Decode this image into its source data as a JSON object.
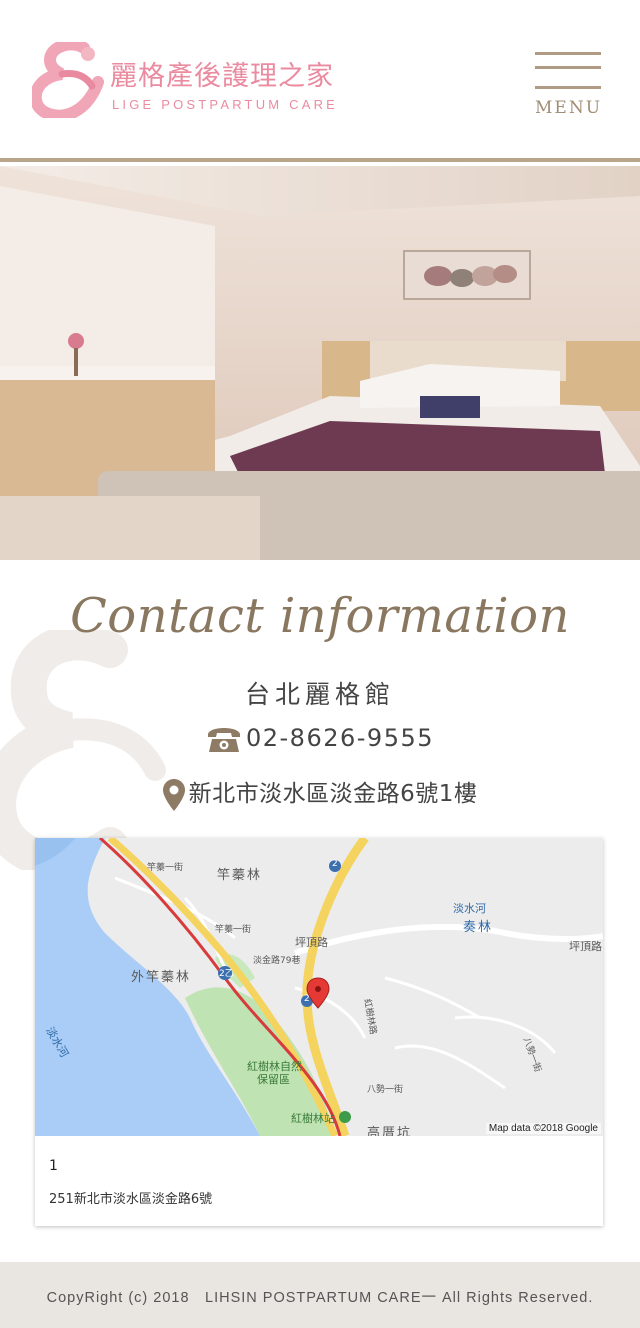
{
  "header": {
    "brand_title": "麗格產後護理之家",
    "brand_subtitle": "LIGE POSTPARTUM CARE",
    "menu_label": "MENU",
    "accent": "#ea8ba0",
    "gold": "#b8a58a"
  },
  "contact": {
    "title": "Contact information",
    "branch": "台北麗格館",
    "phone": "02-8626-9555",
    "address": "新北市淡水區淡金路6號1樓"
  },
  "map": {
    "labels": {
      "north": "竿蓁林",
      "west": "外竿蓁林",
      "reserve1": "紅樹林自然",
      "reserve2": "保留區",
      "station": "紅樹林站",
      "south": "高厝坑",
      "river_ne1": "淡水河",
      "river_ne2": "奏林",
      "river_w": "淡水河",
      "road1": "坪頂路",
      "road2": "坪頂路",
      "road3": "紅樹林路",
      "road4": "八勢一街",
      "road5": "竿蓁一街",
      "road6": "淡金路79巷",
      "road7": "竿蓁一街",
      "road8": "八勢一街",
      "hw1": "2",
      "hw2": "2乙",
      "hw3": "2"
    },
    "attribution": "Map data ©2018 Google",
    "info_number": "1",
    "info_address": "251新北市淡水區淡金路6號"
  },
  "footer": {
    "copyright": "CopyRight (c) 2018　LIHSIN POSTPARTUM CARE一 All Rights Reserved."
  }
}
